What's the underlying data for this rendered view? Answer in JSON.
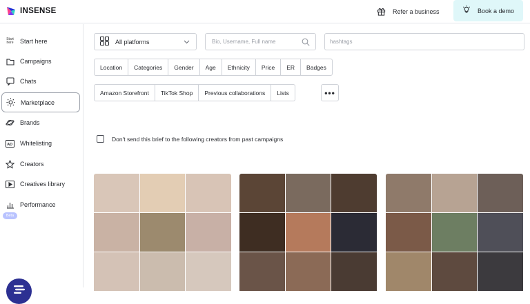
{
  "header": {
    "brand": "INSENSE",
    "refer_label": "Refer a business",
    "demo_label": "Book a demo"
  },
  "sidebar": {
    "items": [
      {
        "label": "Start here",
        "icon": "start-here-icon",
        "active": false
      },
      {
        "label": "Campaigns",
        "icon": "folder-icon",
        "active": false
      },
      {
        "label": "Chats",
        "icon": "chat-icon",
        "active": false
      },
      {
        "label": "Marketplace",
        "icon": "sun-icon",
        "active": true
      },
      {
        "label": "Brands",
        "icon": "planet-icon",
        "active": false
      },
      {
        "label": "Whitelisting",
        "icon": "ad-icon",
        "active": false
      },
      {
        "label": "Creators",
        "icon": "star-icon",
        "active": false
      },
      {
        "label": "Creatives library",
        "icon": "play-icon",
        "active": false
      },
      {
        "label": "Performance",
        "icon": "bar-chart-icon",
        "active": false
      }
    ],
    "start_icon_text": "Start here",
    "beta_badge": "Beta"
  },
  "filters": {
    "platform_value": "All platforms",
    "search_placeholder": "Bio, Username, Full name",
    "hashtags_placeholder": "hashtags",
    "row1": [
      "Location",
      "Categories",
      "Gender",
      "Age",
      "Ethnicity",
      "Price",
      "ER",
      "Badges"
    ],
    "row2": [
      "Amazon Storefront",
      "TikTok Shop",
      "Previous collaborations",
      "Lists"
    ],
    "more_label": "•••"
  },
  "exclude_checkbox": {
    "label": "Don't send this brief to the following creators from past campaigns",
    "checked": false
  },
  "creator_cards": [
    {
      "tiles": [
        "#d9c6b8",
        "#e3cdb4",
        "#d8c4b6",
        "#c9b2a4",
        "#9c8a6e",
        "#c8b0a6",
        "#d4c2b6",
        "#cbbcae",
        "#d6c8bd"
      ]
    },
    {
      "tiles": [
        "#5b4536",
        "#7a6a5e",
        "#4e3c30",
        "#3e2d22",
        "#b57a5c",
        "#2b2b35",
        "#6a5448",
        "#8b6a56",
        "#4a3b33"
      ]
    },
    {
      "tiles": [
        "#8f7a6a",
        "#b7a393",
        "#6d5f58",
        "#7b5a48",
        "#6d7e62",
        "#4f4f58",
        "#a0876a",
        "#5e4a3f",
        "#3c3a3e"
      ]
    }
  ],
  "colors": {
    "accent_teal_bg": "#dff7f9",
    "fab": "#2c3092",
    "beta_badge": "#b9c3ff",
    "border": "#cfd2d8"
  }
}
